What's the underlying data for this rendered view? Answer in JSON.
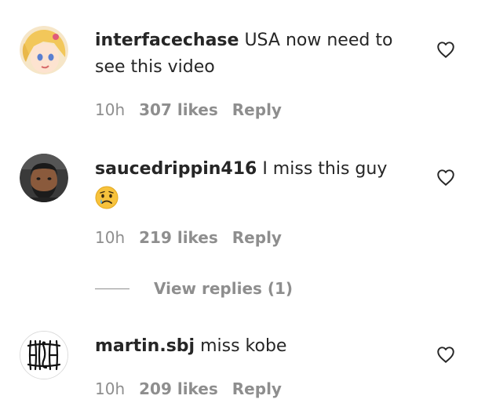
{
  "comments": [
    {
      "username": "interfacechase",
      "text": "USA now need to see this video",
      "emoji": "",
      "time": "10h",
      "likes": "307 likes",
      "reply": "Reply",
      "avatar_icon": "anime-character-avatar"
    },
    {
      "username": "saucedrippin416",
      "text": "I miss this guy",
      "emoji": "😥",
      "time": "10h",
      "likes": "219 likes",
      "reply": "Reply",
      "avatar_icon": "person-photo-avatar"
    },
    {
      "username": "martin.sbj",
      "text": "miss kobe",
      "emoji": "",
      "time": "10h",
      "likes": "209 likes",
      "reply": "Reply",
      "avatar_icon": "high-logo-avatar"
    }
  ],
  "view_replies": {
    "label": "View replies (1)"
  },
  "colors": {
    "text": "#262626",
    "secondary": "#8e8e8e",
    "background": "#ffffff"
  }
}
